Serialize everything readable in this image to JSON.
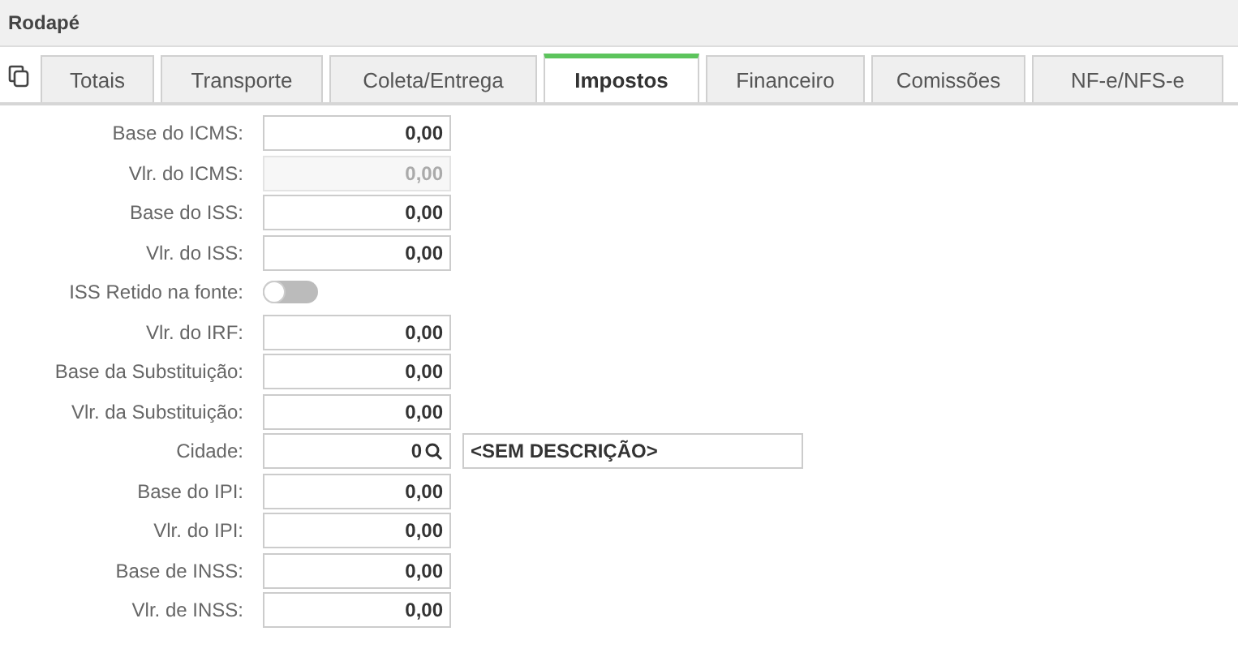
{
  "panel": {
    "title": "Rodapé"
  },
  "tabs": [
    {
      "label": "Totais",
      "selected": false
    },
    {
      "label": "Transporte",
      "selected": false
    },
    {
      "label": "Coleta/Entrega",
      "selected": false
    },
    {
      "label": "Impostos",
      "selected": true
    },
    {
      "label": "Financeiro",
      "selected": false
    },
    {
      "label": "Comissões",
      "selected": false
    },
    {
      "label": "NF-e/NFS-e",
      "selected": false
    }
  ],
  "fields": [
    {
      "kind": "number",
      "label": "Base do ICMS:",
      "value": "0,00",
      "disabled": false
    },
    {
      "kind": "number",
      "label": "Vlr. do ICMS:",
      "value": "0,00",
      "disabled": true
    },
    {
      "kind": "number",
      "label": "Base do ISS:",
      "value": "0,00",
      "disabled": false
    },
    {
      "kind": "number",
      "label": "Vlr. do ISS:",
      "value": "0,00",
      "disabled": false
    },
    {
      "kind": "toggle",
      "label": "ISS Retido na fonte:",
      "on": false
    },
    {
      "kind": "number",
      "label": "Vlr. do IRF:",
      "value": "0,00",
      "disabled": false
    },
    {
      "kind": "number",
      "label": "Base da Substituição:",
      "value": "0,00",
      "disabled": false
    },
    {
      "kind": "number",
      "label": "Vlr. da Substituição:",
      "value": "0,00",
      "disabled": false
    },
    {
      "kind": "lookup",
      "label": "Cidade:",
      "value": "0",
      "description": "<SEM DESCRIÇÃO>"
    },
    {
      "kind": "number",
      "label": "Base do IPI:",
      "value": "0,00",
      "disabled": false
    },
    {
      "kind": "number",
      "label": "Vlr. do IPI:",
      "value": "0,00",
      "disabled": false
    },
    {
      "kind": "number",
      "label": "Base de INSS:",
      "value": "0,00",
      "disabled": false
    },
    {
      "kind": "number",
      "label": "Vlr. de INSS:",
      "value": "0,00",
      "disabled": false
    }
  ]
}
